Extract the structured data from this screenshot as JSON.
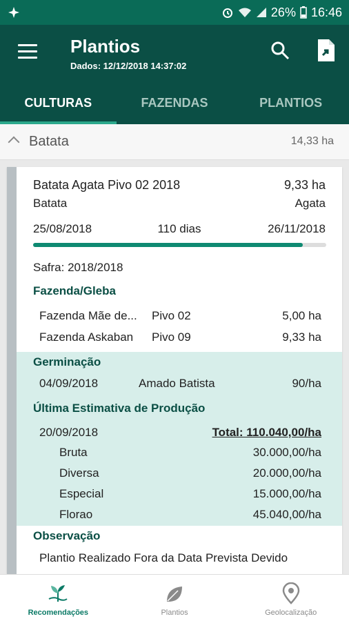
{
  "status_bar": {
    "battery": "26%",
    "time": "16:46"
  },
  "app_bar": {
    "title": "Plantios",
    "subtitle": "Dados: 12/12/2018 14:37:02"
  },
  "tabs": [
    {
      "label": "CULTURAS",
      "active": true
    },
    {
      "label": "FAZENDAS",
      "active": false
    },
    {
      "label": "PLANTIOS",
      "active": false
    }
  ],
  "group": {
    "name": "Batata",
    "area": "14,33 ha"
  },
  "card": {
    "title": "Batata Agata Pivo 02 2018",
    "area": "9,33 ha",
    "crop": "Batata",
    "variety": "Agata",
    "start_date": "25/08/2018",
    "duration": "110 dias",
    "end_date": "26/11/2018",
    "progress": 0.92,
    "safra": "Safra: 2018/2018",
    "fazenda_label": "Fazenda/Gleba",
    "fazendas": [
      {
        "name": "Fazenda Mãe de...",
        "gleba": "Pivo 02",
        "area": "5,00 ha"
      },
      {
        "name": "Fazenda Askaban",
        "gleba": "Pivo 09",
        "area": "9,33 ha"
      }
    ],
    "germinacao_label": "Germinação",
    "germinacao": {
      "date": "04/09/2018",
      "person": "Amado Batista",
      "value": "90/ha"
    },
    "estimativa_label": "Última Estimativa de Produção",
    "estimativa": {
      "date": "20/09/2018",
      "total": "Total: 110.040,00/ha",
      "items": [
        {
          "label": "Bruta",
          "value": "30.000,00/ha"
        },
        {
          "label": "Diversa",
          "value": "20.000,00/ha"
        },
        {
          "label": "Especial",
          "value": "15.000,00/ha"
        },
        {
          "label": "Florao",
          "value": "45.040,00/ha"
        }
      ]
    },
    "observacao_label": "Observação",
    "observacao_text": "Plantio Realizado Fora da Data Prevista Devido"
  },
  "bottom_nav": [
    {
      "label": "Recomendações",
      "icon": "plant-hand-icon",
      "active": true
    },
    {
      "label": "Plantios",
      "icon": "leaf-icon",
      "active": false
    },
    {
      "label": "Geolocalização",
      "icon": "location-pin-icon",
      "active": false
    }
  ],
  "colors": {
    "primary": "#0b4f45",
    "status": "#0a6b57",
    "accent": "#2ca98c",
    "highlight": "#d7eeea"
  }
}
